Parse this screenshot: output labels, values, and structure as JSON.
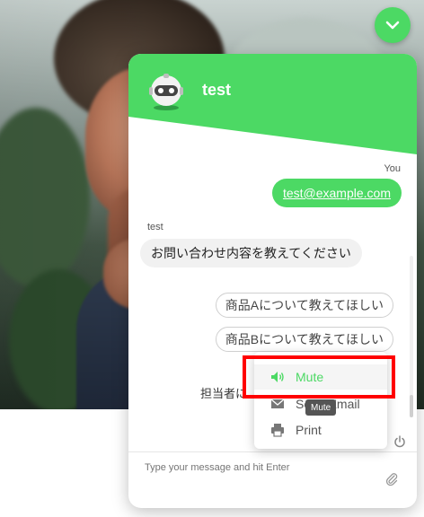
{
  "colors": {
    "accent": "#4cd964",
    "highlight": "#ff0000"
  },
  "background": {
    "description_icon": "photo-background"
  },
  "toggle": {
    "icon": "chevron-down-icon"
  },
  "widget": {
    "bot_name": "test",
    "messages": [
      {
        "sender": "You",
        "text": "test@example.com"
      },
      {
        "sender": "test",
        "text": "お問い合わせ内容を教えてください"
      }
    ],
    "quick_replies": [
      "商品Aについて教えてほしい",
      "商品Bについて教えてほしい"
    ],
    "partial_message": "担当者に",
    "composer_placeholder": "Type your message and hit Enter"
  },
  "menu": {
    "items": [
      {
        "label": "Mute",
        "icon": "speaker-icon"
      },
      {
        "label": "Send Email",
        "icon": "envelope-icon"
      },
      {
        "label": "Print",
        "icon": "printer-icon"
      }
    ],
    "tooltip": "Mute"
  }
}
